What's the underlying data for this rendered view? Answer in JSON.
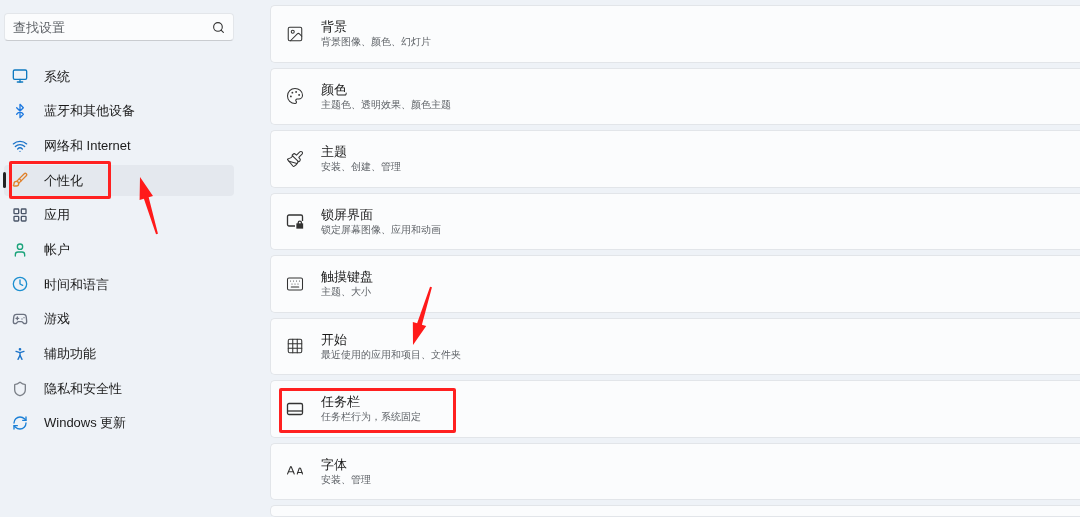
{
  "search": {
    "placeholder": "查找设置"
  },
  "nav": [
    {
      "label": "系统",
      "selected": false,
      "annotated": false
    },
    {
      "label": "蓝牙和其他设备",
      "selected": false,
      "annotated": false
    },
    {
      "label": "网络和 Internet",
      "selected": false,
      "annotated": false
    },
    {
      "label": "个性化",
      "selected": true,
      "annotated": true
    },
    {
      "label": "应用",
      "selected": false,
      "annotated": false
    },
    {
      "label": "帐户",
      "selected": false,
      "annotated": false
    },
    {
      "label": "时间和语言",
      "selected": false,
      "annotated": false
    },
    {
      "label": "游戏",
      "selected": false,
      "annotated": false
    },
    {
      "label": "辅助功能",
      "selected": false,
      "annotated": false
    },
    {
      "label": "隐私和安全性",
      "selected": false,
      "annotated": false
    },
    {
      "label": "Windows 更新",
      "selected": false,
      "annotated": false
    }
  ],
  "cards": [
    {
      "title": "背景",
      "subtitle": "背景图像、颜色、幻灯片",
      "annotated": false
    },
    {
      "title": "颜色",
      "subtitle": "主题色、透明效果、颜色主题",
      "annotated": false
    },
    {
      "title": "主题",
      "subtitle": "安装、创建、管理",
      "annotated": false
    },
    {
      "title": "锁屏界面",
      "subtitle": "锁定屏幕图像、应用和动画",
      "annotated": false
    },
    {
      "title": "触摸键盘",
      "subtitle": "主题、大小",
      "annotated": false
    },
    {
      "title": "开始",
      "subtitle": "最近使用的应用和项目、文件夹",
      "annotated": false
    },
    {
      "title": "任务栏",
      "subtitle": "任务栏行为，系统固定",
      "annotated": true
    },
    {
      "title": "字体",
      "subtitle": "安装、管理",
      "annotated": false
    }
  ]
}
